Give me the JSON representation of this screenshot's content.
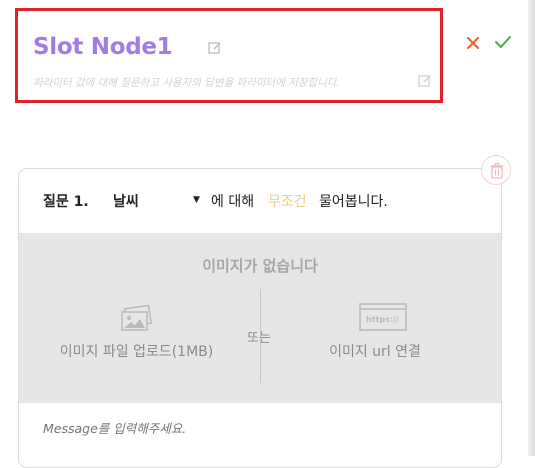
{
  "node": {
    "title": "Slot Node1",
    "description": "파라미터 값에 대해 질문하고 사용자의 답변을 파라미터에 저장합니다."
  },
  "actions": {
    "cancel_icon": "close-x",
    "confirm_icon": "checkmark"
  },
  "question": {
    "label": "질문 1.",
    "selected_param": "날씨",
    "about": "에 대해",
    "condition": "무조건",
    "ask": "물어봅니다."
  },
  "image_panel": {
    "empty_text": "이미지가 없습니다",
    "upload_label": "이미지 파일 업로드(1MB)",
    "or_text": "또는",
    "url_label": "이미지 url 연결",
    "url_icon_text": "https://"
  },
  "message": {
    "placeholder": "Message를 입력해주세요."
  },
  "colors": {
    "title": "#a27ce4",
    "highlight_border": "#e0202a",
    "cancel": "#e8602c",
    "confirm": "#3fb14a",
    "condition": "#f4c98a",
    "panel_bg": "#e6e6e6"
  }
}
